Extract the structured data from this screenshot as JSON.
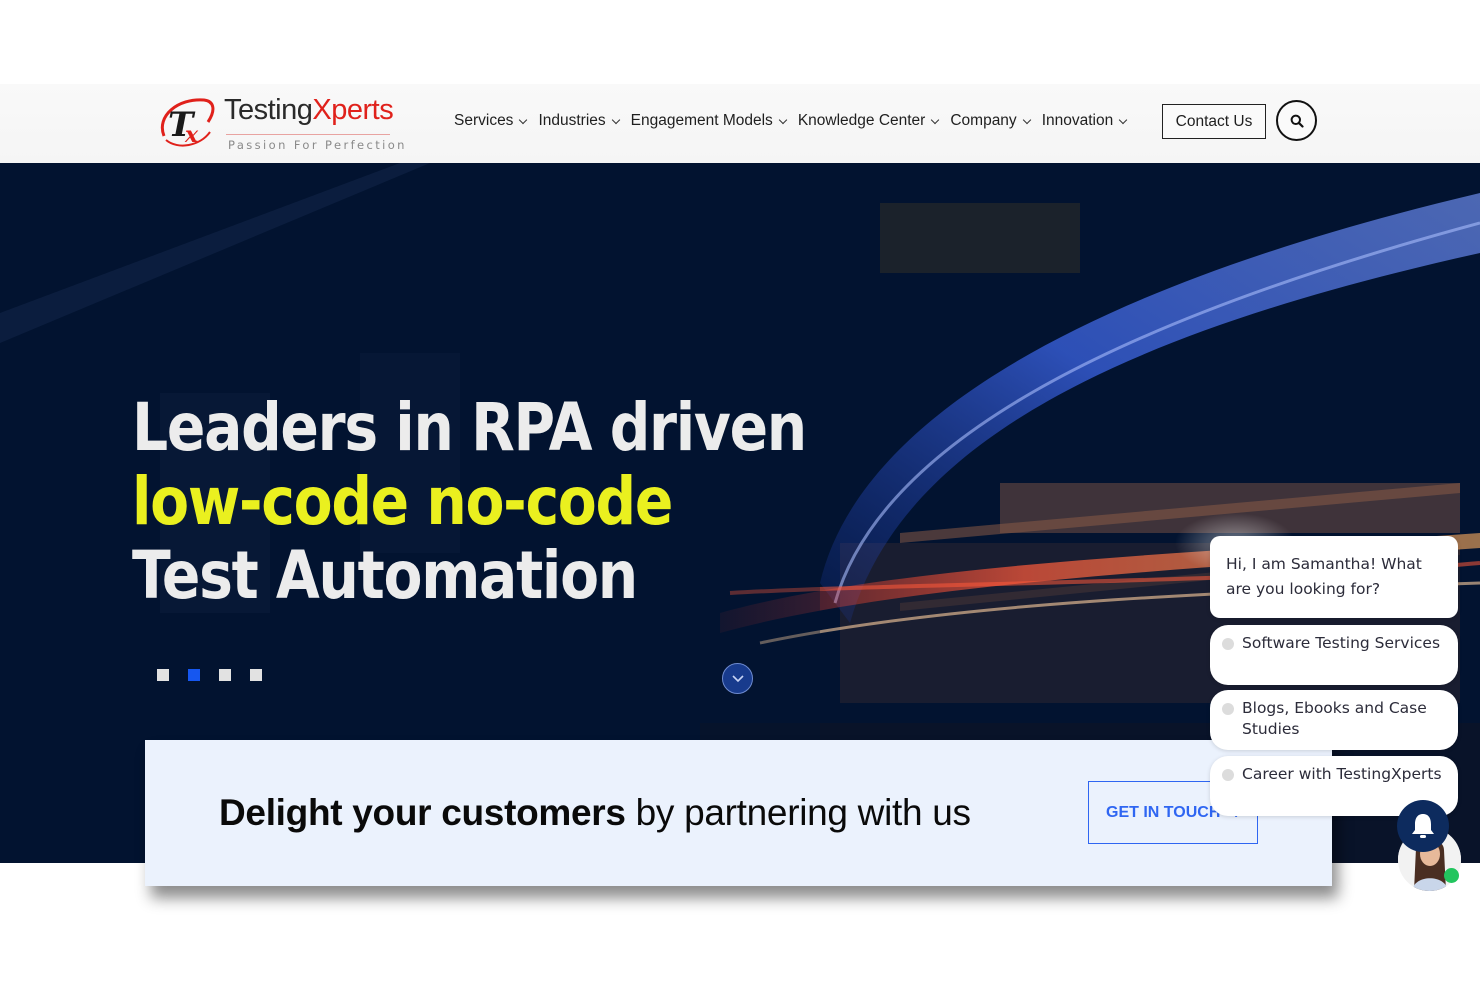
{
  "header": {
    "logo": {
      "name_part1": "Testing",
      "name_part2": "Xperts",
      "tagline": "Passion For Perfection",
      "mark": "TX"
    },
    "nav": [
      {
        "label": "Services",
        "icon": "chevron-down-icon"
      },
      {
        "label": "Industries",
        "icon": "chevron-down-icon"
      },
      {
        "label": "Engagement Models",
        "icon": "chevron-down-icon"
      },
      {
        "label": "Knowledge Center",
        "icon": "chevron-down-icon"
      },
      {
        "label": "Company",
        "icon": "chevron-down-icon"
      },
      {
        "label": "Innovation",
        "icon": "chevron-down-icon"
      }
    ],
    "contact_label": "Contact Us",
    "search_icon": "search-icon"
  },
  "hero": {
    "line1": "Leaders in RPA driven",
    "line2": "low-code no-code",
    "line3": "Test Automation",
    "slides_total": 4,
    "active_slide": 2,
    "scroll_icon": "chevron-down-icon",
    "colors": {
      "title": "#ececec",
      "highlight": "#eaf01f",
      "active_dot": "#1657f0",
      "background": "#031431"
    }
  },
  "cta": {
    "bold_text": "Delight your customers",
    "rest_text": " by partnering with us",
    "button_label": "GET IN TOUCH",
    "button_icon": "arrow-right-icon",
    "accent": "#2f66f2"
  },
  "chat": {
    "greeting": "Hi, I am Samantha! What are you looking for?",
    "options": [
      "Software Testing Services",
      "Blogs, Ebooks and Case Studies",
      "Career with TestingXperts"
    ],
    "bell_icon": "bell-icon",
    "status": "online",
    "status_color": "#22c55e"
  }
}
